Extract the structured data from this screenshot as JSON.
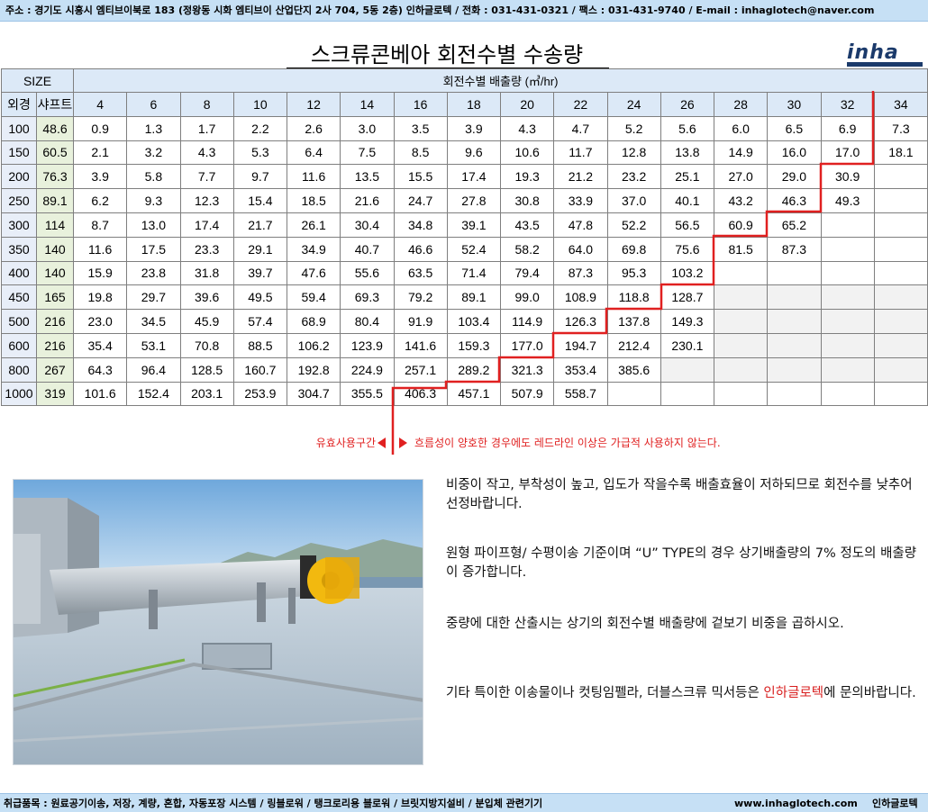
{
  "header": {
    "contact": "주소 : 경기도 시흥시 엠티브이북로 183 (정왕동 시화 엠티브이 산업단지 2사 704, 5동 2층) 인하글로텍 / 전화 : 031-431-0321 / 팩스 : 031-431-9740 / E-mail : inhaglotech@naver.com"
  },
  "title": "스크류콘베아 회전수별 수송량",
  "logo": {
    "text": "inha"
  },
  "table": {
    "size_label": "SIZE",
    "rpm_caption": "회전수별 배출량 (㎥/hr)",
    "col_dia_label": "외경",
    "col_shaft_label": "샤프트",
    "rpm_headers": [
      "4",
      "6",
      "8",
      "10",
      "12",
      "14",
      "16",
      "18",
      "20",
      "22",
      "24",
      "26",
      "28",
      "30",
      "32",
      "34"
    ],
    "rows": [
      {
        "dia": "100",
        "shaft": "48.6",
        "values": [
          "0.9",
          "1.3",
          "1.7",
          "2.2",
          "2.6",
          "3.0",
          "3.5",
          "3.9",
          "4.3",
          "4.7",
          "5.2",
          "5.6",
          "6.0",
          "6.5",
          "6.9",
          "7.3"
        ]
      },
      {
        "dia": "150",
        "shaft": "60.5",
        "values": [
          "2.1",
          "3.2",
          "4.3",
          "5.3",
          "6.4",
          "7.5",
          "8.5",
          "9.6",
          "10.6",
          "11.7",
          "12.8",
          "13.8",
          "14.9",
          "16.0",
          "17.0",
          "18.1"
        ]
      },
      {
        "dia": "200",
        "shaft": "76.3",
        "values": [
          "3.9",
          "5.8",
          "7.7",
          "9.7",
          "11.6",
          "13.5",
          "15.5",
          "17.4",
          "19.3",
          "21.2",
          "23.2",
          "25.1",
          "27.0",
          "29.0",
          "30.9",
          ""
        ]
      },
      {
        "dia": "250",
        "shaft": "89.1",
        "values": [
          "6.2",
          "9.3",
          "12.3",
          "15.4",
          "18.5",
          "21.6",
          "24.7",
          "27.8",
          "30.8",
          "33.9",
          "37.0",
          "40.1",
          "43.2",
          "46.3",
          "49.3",
          ""
        ]
      },
      {
        "dia": "300",
        "shaft": "114",
        "values": [
          "8.7",
          "13.0",
          "17.4",
          "21.7",
          "26.1",
          "30.4",
          "34.8",
          "39.1",
          "43.5",
          "47.8",
          "52.2",
          "56.5",
          "60.9",
          "65.2",
          "",
          ""
        ]
      },
      {
        "dia": "350",
        "shaft": "140",
        "values": [
          "11.6",
          "17.5",
          "23.3",
          "29.1",
          "34.9",
          "40.7",
          "46.6",
          "52.4",
          "58.2",
          "64.0",
          "69.8",
          "75.6",
          "81.5",
          "87.3",
          "",
          ""
        ]
      },
      {
        "dia": "400",
        "shaft": "140",
        "values": [
          "15.9",
          "23.8",
          "31.8",
          "39.7",
          "47.6",
          "55.6",
          "63.5",
          "71.4",
          "79.4",
          "87.3",
          "95.3",
          "103.2",
          "",
          "",
          "",
          ""
        ]
      },
      {
        "dia": "450",
        "shaft": "165",
        "values": [
          "19.8",
          "29.7",
          "39.6",
          "49.5",
          "59.4",
          "69.3",
          "79.2",
          "89.1",
          "99.0",
          "108.9",
          "118.8",
          "128.7",
          "",
          "",
          "",
          ""
        ]
      },
      {
        "dia": "500",
        "shaft": "216",
        "values": [
          "23.0",
          "34.5",
          "45.9",
          "57.4",
          "68.9",
          "80.4",
          "91.9",
          "103.4",
          "114.9",
          "126.3",
          "137.8",
          "149.3",
          "",
          "",
          "",
          ""
        ]
      },
      {
        "dia": "600",
        "shaft": "216",
        "values": [
          "35.4",
          "53.1",
          "70.8",
          "88.5",
          "106.2",
          "123.9",
          "141.6",
          "159.3",
          "177.0",
          "194.7",
          "212.4",
          "230.1",
          "",
          "",
          "",
          ""
        ]
      },
      {
        "dia": "800",
        "shaft": "267",
        "values": [
          "64.3",
          "96.4",
          "128.5",
          "160.7",
          "192.8",
          "224.9",
          "257.1",
          "289.2",
          "321.3",
          "353.4",
          "385.6",
          "",
          "",
          "",
          "",
          ""
        ]
      },
      {
        "dia": "1000",
        "shaft": "319",
        "values": [
          "101.6",
          "152.4",
          "203.1",
          "253.9",
          "304.7",
          "355.5",
          "406.3",
          "457.1",
          "507.9",
          "558.7",
          "",
          "",
          "",
          "",
          "",
          ""
        ]
      }
    ],
    "grey_cells": [
      [
        7,
        12
      ],
      [
        7,
        13
      ],
      [
        7,
        14
      ],
      [
        7,
        15
      ],
      [
        8,
        12
      ],
      [
        8,
        13
      ],
      [
        8,
        14
      ],
      [
        8,
        15
      ],
      [
        9,
        12
      ],
      [
        9,
        13
      ],
      [
        9,
        14
      ],
      [
        9,
        15
      ],
      [
        10,
        11
      ],
      [
        10,
        12
      ],
      [
        10,
        13
      ],
      [
        10,
        14
      ],
      [
        10,
        15
      ]
    ]
  },
  "legend": {
    "left": "유효사용구간",
    "right": "흐름성이 양호한 경우에도 레드라인 이상은 가급적 사용하지 않는다."
  },
  "notes": {
    "n1": "비중이 작고, 부착성이 높고, 입도가 작을수록 배출효율이 저하되므로 회전수를 낮추어 선정바랍니다.",
    "n2": "원형 파이프형/ 수평이송 기준이며 “U” TYPE의 경우 상기배출량의 7% 정도의 배출량이 증가합니다.",
    "n3": "중량에 대한 산출시는 상기의 회전수별 배출량에 겉보기 비중을 곱하시오.",
    "n4_prefix": "기타 특이한 이송물이나 컷팅임펠라, 더블스크류 믹서등은 ",
    "n4_brand": "인하글로텍",
    "n4_suffix": "에 문의바랍니다."
  },
  "footer": {
    "products": "취급품목 : 원료공기이송, 저장, 계량, 혼합, 자동포장 시스템 / 링블로워 / 탱크로리용 블로워 / 브릿지방지설비 / 분입체 관련기기",
    "url": "www.inhaglotech.com",
    "company": "인하글로텍"
  },
  "colors": {
    "header_blue": "#c6e0f5",
    "redline": "#e02020",
    "brand_red": "#d81e1e"
  }
}
